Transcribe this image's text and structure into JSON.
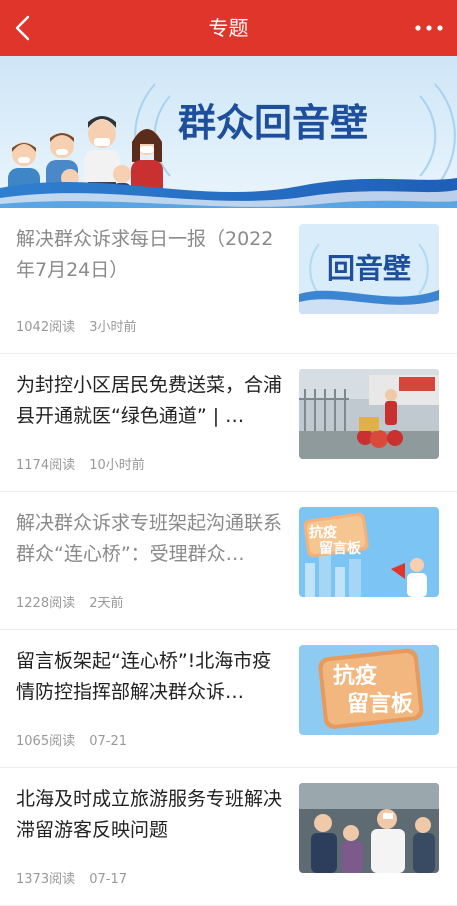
{
  "header": {
    "title": "专题",
    "back_icon": "chevron-left-icon",
    "more_icon": "more-horizontal-icon",
    "bg_color": "#e0352b"
  },
  "banner": {
    "title_text": "群众回音壁"
  },
  "articles": [
    {
      "title": "解决群众诉求每日一报（2022年7月24日）",
      "reads": "1042阅读",
      "time": "3小时前",
      "read_state": "read",
      "thumb": {
        "type": "echo-wall",
        "text": "回音壁"
      }
    },
    {
      "title": "为封控小区居民免费送菜，合浦县开通就医“绿色通道” | …",
      "reads": "1174阅读",
      "time": "10小时前",
      "read_state": "unread",
      "thumb": {
        "type": "photo-vegetables"
      }
    },
    {
      "title": "解决群众诉求专班架起沟通联系群众“连心桥”：受理群众…",
      "reads": "1228阅读",
      "time": "2天前",
      "read_state": "read",
      "thumb": {
        "type": "message-board",
        "line1": "抗疫",
        "line2": "留言板"
      }
    },
    {
      "title": "留言板架起“连心桥”!北海市疫情防控指挥部解决群众诉…",
      "reads": "1065阅读",
      "time": "07-21",
      "read_state": "unread",
      "thumb": {
        "type": "message-board-close",
        "line1": "抗疫",
        "line2": "留言板"
      }
    },
    {
      "title": "北海及时成立旅游服务专班解决滞留游客反映问题",
      "reads": "1373阅读",
      "time": "07-17",
      "read_state": "unread",
      "thumb": {
        "type": "photo-officers"
      }
    }
  ]
}
